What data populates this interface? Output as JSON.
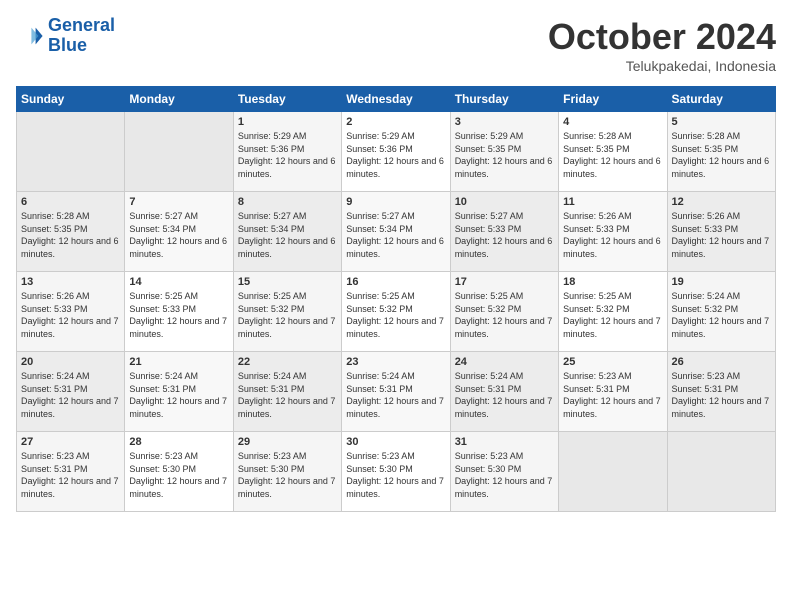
{
  "logo": {
    "line1": "General",
    "line2": "Blue"
  },
  "calendar": {
    "title": "October 2024",
    "subtitle": "Telukpakedai, Indonesia"
  },
  "headers": [
    "Sunday",
    "Monday",
    "Tuesday",
    "Wednesday",
    "Thursday",
    "Friday",
    "Saturday"
  ],
  "weeks": [
    [
      {
        "day": "",
        "info": ""
      },
      {
        "day": "",
        "info": ""
      },
      {
        "day": "1",
        "sunrise": "5:29 AM",
        "sunset": "5:36 PM",
        "daylight": "12 hours and 6 minutes."
      },
      {
        "day": "2",
        "sunrise": "5:29 AM",
        "sunset": "5:36 PM",
        "daylight": "12 hours and 6 minutes."
      },
      {
        "day": "3",
        "sunrise": "5:29 AM",
        "sunset": "5:35 PM",
        "daylight": "12 hours and 6 minutes."
      },
      {
        "day": "4",
        "sunrise": "5:28 AM",
        "sunset": "5:35 PM",
        "daylight": "12 hours and 6 minutes."
      },
      {
        "day": "5",
        "sunrise": "5:28 AM",
        "sunset": "5:35 PM",
        "daylight": "12 hours and 6 minutes."
      }
    ],
    [
      {
        "day": "6",
        "sunrise": "5:28 AM",
        "sunset": "5:35 PM",
        "daylight": "12 hours and 6 minutes."
      },
      {
        "day": "7",
        "sunrise": "5:27 AM",
        "sunset": "5:34 PM",
        "daylight": "12 hours and 6 minutes."
      },
      {
        "day": "8",
        "sunrise": "5:27 AM",
        "sunset": "5:34 PM",
        "daylight": "12 hours and 6 minutes."
      },
      {
        "day": "9",
        "sunrise": "5:27 AM",
        "sunset": "5:34 PM",
        "daylight": "12 hours and 6 minutes."
      },
      {
        "day": "10",
        "sunrise": "5:27 AM",
        "sunset": "5:33 PM",
        "daylight": "12 hours and 6 minutes."
      },
      {
        "day": "11",
        "sunrise": "5:26 AM",
        "sunset": "5:33 PM",
        "daylight": "12 hours and 6 minutes."
      },
      {
        "day": "12",
        "sunrise": "5:26 AM",
        "sunset": "5:33 PM",
        "daylight": "12 hours and 7 minutes."
      }
    ],
    [
      {
        "day": "13",
        "sunrise": "5:26 AM",
        "sunset": "5:33 PM",
        "daylight": "12 hours and 7 minutes."
      },
      {
        "day": "14",
        "sunrise": "5:25 AM",
        "sunset": "5:33 PM",
        "daylight": "12 hours and 7 minutes."
      },
      {
        "day": "15",
        "sunrise": "5:25 AM",
        "sunset": "5:32 PM",
        "daylight": "12 hours and 7 minutes."
      },
      {
        "day": "16",
        "sunrise": "5:25 AM",
        "sunset": "5:32 PM",
        "daylight": "12 hours and 7 minutes."
      },
      {
        "day": "17",
        "sunrise": "5:25 AM",
        "sunset": "5:32 PM",
        "daylight": "12 hours and 7 minutes."
      },
      {
        "day": "18",
        "sunrise": "5:25 AM",
        "sunset": "5:32 PM",
        "daylight": "12 hours and 7 minutes."
      },
      {
        "day": "19",
        "sunrise": "5:24 AM",
        "sunset": "5:32 PM",
        "daylight": "12 hours and 7 minutes."
      }
    ],
    [
      {
        "day": "20",
        "sunrise": "5:24 AM",
        "sunset": "5:31 PM",
        "daylight": "12 hours and 7 minutes."
      },
      {
        "day": "21",
        "sunrise": "5:24 AM",
        "sunset": "5:31 PM",
        "daylight": "12 hours and 7 minutes."
      },
      {
        "day": "22",
        "sunrise": "5:24 AM",
        "sunset": "5:31 PM",
        "daylight": "12 hours and 7 minutes."
      },
      {
        "day": "23",
        "sunrise": "5:24 AM",
        "sunset": "5:31 PM",
        "daylight": "12 hours and 7 minutes."
      },
      {
        "day": "24",
        "sunrise": "5:24 AM",
        "sunset": "5:31 PM",
        "daylight": "12 hours and 7 minutes."
      },
      {
        "day": "25",
        "sunrise": "5:23 AM",
        "sunset": "5:31 PM",
        "daylight": "12 hours and 7 minutes."
      },
      {
        "day": "26",
        "sunrise": "5:23 AM",
        "sunset": "5:31 PM",
        "daylight": "12 hours and 7 minutes."
      }
    ],
    [
      {
        "day": "27",
        "sunrise": "5:23 AM",
        "sunset": "5:31 PM",
        "daylight": "12 hours and 7 minutes."
      },
      {
        "day": "28",
        "sunrise": "5:23 AM",
        "sunset": "5:30 PM",
        "daylight": "12 hours and 7 minutes."
      },
      {
        "day": "29",
        "sunrise": "5:23 AM",
        "sunset": "5:30 PM",
        "daylight": "12 hours and 7 minutes."
      },
      {
        "day": "30",
        "sunrise": "5:23 AM",
        "sunset": "5:30 PM",
        "daylight": "12 hours and 7 minutes."
      },
      {
        "day": "31",
        "sunrise": "5:23 AM",
        "sunset": "5:30 PM",
        "daylight": "12 hours and 7 minutes."
      },
      {
        "day": "",
        "info": ""
      },
      {
        "day": "",
        "info": ""
      }
    ]
  ]
}
